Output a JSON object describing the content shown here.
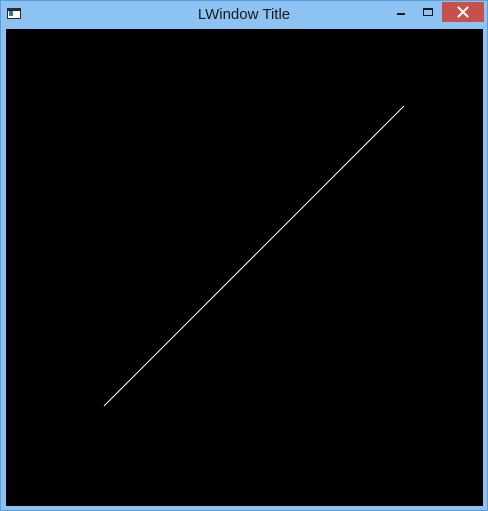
{
  "window": {
    "title": "LWindow Title",
    "frame_color": "#8cc3f2",
    "close_color": "#c7504b"
  },
  "canvas": {
    "background": "#000000",
    "line_color": "#ffffff"
  }
}
